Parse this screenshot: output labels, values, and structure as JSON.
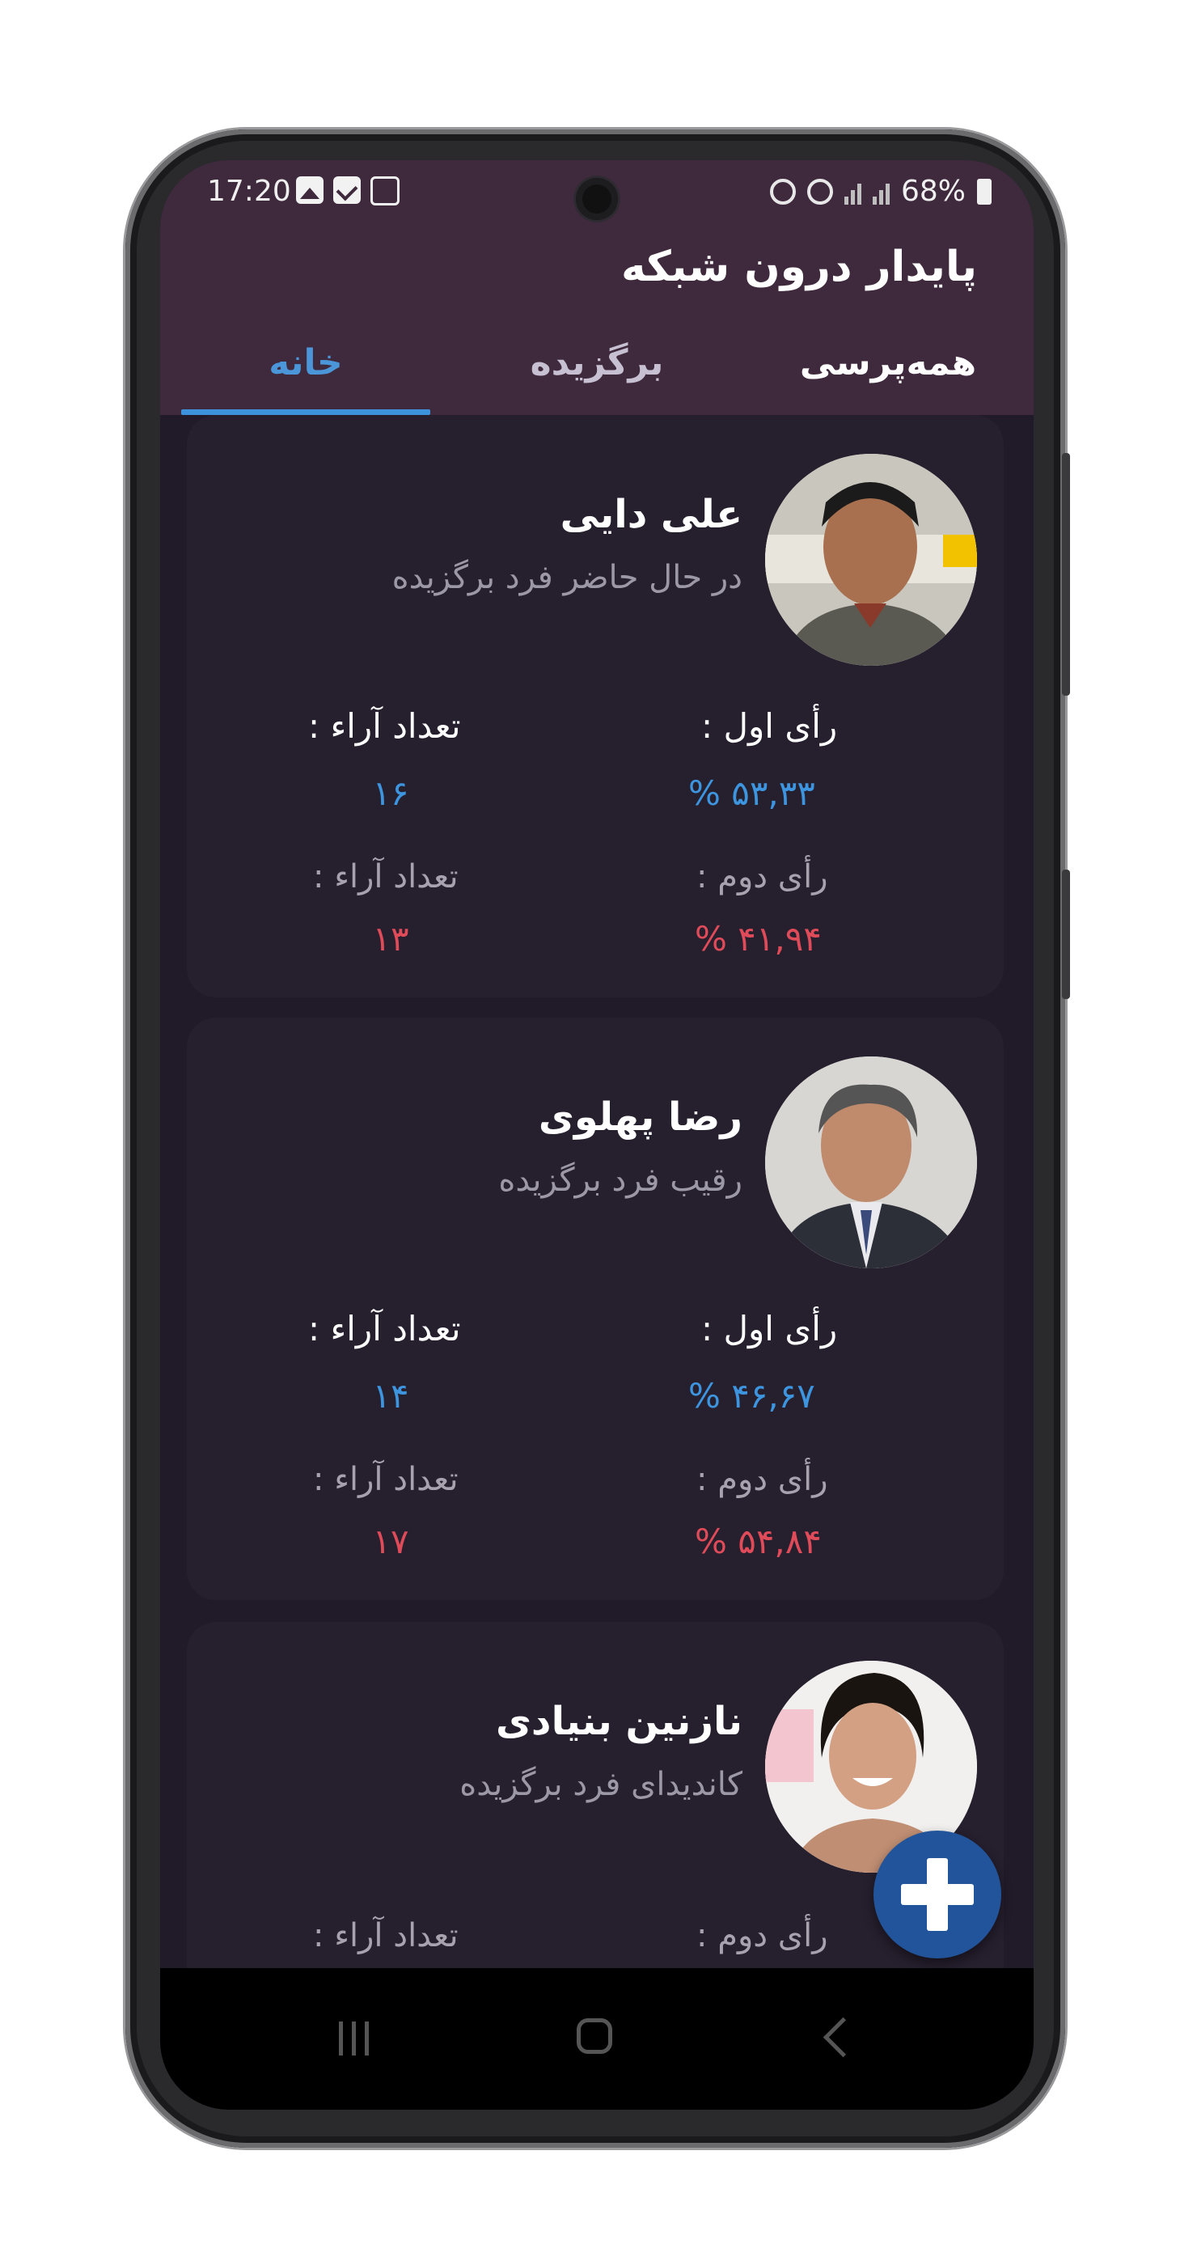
{
  "status_bar": {
    "time": "17:20",
    "battery": "68%",
    "icons": [
      "image-icon",
      "check-icon",
      "chip-icon",
      "alarm-icon",
      "wifi-icon",
      "signal-icon",
      "signal-icon",
      "battery-icon"
    ]
  },
  "header": {
    "title": "پایدار درون شبکه"
  },
  "tabs": [
    {
      "label": "همه‌پرسی",
      "state": "normal"
    },
    {
      "label": "برگزیده",
      "state": "dim"
    },
    {
      "label": "خانه",
      "state": "active"
    }
  ],
  "cards": [
    {
      "name": "علی دایی",
      "subtitle": "در حال حاضر فرد برگزیده",
      "first_vote_label": "رأی اول :",
      "first_vote_value": "۵۳,۳۳ %",
      "first_count_label": "تعداد آراء :",
      "first_count_value": "۱۶",
      "second_vote_label": "رأی دوم :",
      "second_vote_value": "۴۱,۹۴ %",
      "second_count_label": "تعداد آراء :",
      "second_count_value": "۱۳"
    },
    {
      "name": "رضا پهلوی",
      "subtitle": "رقیب فرد برگزیده",
      "first_vote_label": "رأی اول :",
      "first_vote_value": "۴۶,۶۷ %",
      "first_count_label": "تعداد آراء :",
      "first_count_value": "۱۴",
      "second_vote_label": "رأی دوم :",
      "second_vote_value": "۵۴,۸۴ %",
      "second_count_label": "تعداد آراء :",
      "second_count_value": "۱۷"
    },
    {
      "name": "نازنین بنیادی",
      "subtitle": "کاندیدای فرد برگزیده",
      "second_vote_label": "رأی دوم :",
      "second_count_label": "تعداد آراء :"
    }
  ],
  "colors": {
    "appbar": "#3f2a3d",
    "background": "#211a29",
    "card": "#261f2e",
    "accent_blue": "#3d95e0",
    "accent_red": "#e04b5a",
    "fab": "#21549a"
  },
  "fab": {
    "icon": "plus-icon"
  }
}
